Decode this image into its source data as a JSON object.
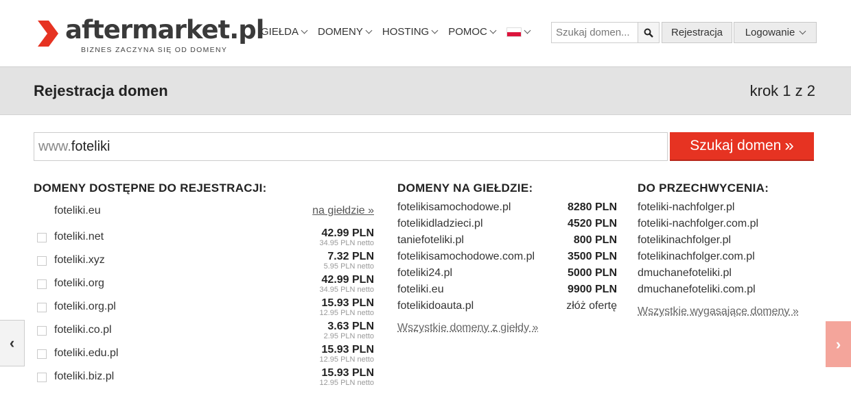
{
  "header": {
    "logo_name": "aftermarket.pl",
    "logo_tagline": "BIZNES ZACZYNA SIĘ OD DOMENY",
    "nav": [
      {
        "label": "GIEŁDA"
      },
      {
        "label": "DOMENY"
      },
      {
        "label": "HOSTING"
      },
      {
        "label": "POMOC"
      }
    ],
    "language_icon": "poland-flag-icon",
    "search_placeholder": "Szukaj domen...",
    "register_label": "Rejestracja",
    "login_label": "Logowanie"
  },
  "titlebar": {
    "title": "Rejestracja domen",
    "step": "krok 1 z 2"
  },
  "domain_search": {
    "prefix": "www.",
    "value": "foteliki",
    "button_label": "Szukaj domen",
    "button_icon": "double-chevron-right-icon"
  },
  "available": {
    "heading": "DOMENY DOSTĘPNE DO REJESTRACJI:",
    "first": {
      "domain": "foteliki.eu",
      "link": "na giełdzie »"
    },
    "items": [
      {
        "domain": "foteliki.net",
        "price": "42.99 PLN",
        "net": "34.95 PLN netto"
      },
      {
        "domain": "foteliki.xyz",
        "price": "7.32 PLN",
        "net": "5.95 PLN netto"
      },
      {
        "domain": "foteliki.org",
        "price": "42.99 PLN",
        "net": "34.95 PLN netto"
      },
      {
        "domain": "foteliki.org.pl",
        "price": "15.93 PLN",
        "net": "12.95 PLN netto"
      },
      {
        "domain": "foteliki.co.pl",
        "price": "3.63 PLN",
        "net": "2.95 PLN netto"
      },
      {
        "domain": "foteliki.edu.pl",
        "price": "15.93 PLN",
        "net": "12.95 PLN netto"
      },
      {
        "domain": "foteliki.biz.pl",
        "price": "15.93 PLN",
        "net": "12.95 PLN netto"
      }
    ]
  },
  "market": {
    "heading": "DOMENY NA GIEŁDZIE:",
    "items": [
      {
        "domain": "fotelikisamochodowe.pl",
        "price": "8280 PLN"
      },
      {
        "domain": "fotelikidladzieci.pl",
        "price": "4520 PLN"
      },
      {
        "domain": "taniefoteliki.pl",
        "price": "800 PLN"
      },
      {
        "domain": "fotelikisamochodowe.com.pl",
        "price": "3500 PLN"
      },
      {
        "domain": "foteliki24.pl",
        "price": "5000 PLN"
      },
      {
        "domain": "foteliki.eu",
        "price": "9900 PLN"
      },
      {
        "domain": "fotelikidoauta.pl",
        "offer": "złóż ofertę"
      }
    ],
    "all_link": "Wszystkie domeny z giełdy »"
  },
  "expiring": {
    "heading": "DO PRZECHWYCENIA:",
    "items": [
      "foteliki-nachfolger.pl",
      "foteliki-nachfolger.com.pl",
      "fotelikinachfolger.pl",
      "fotelikinachfolger.com.pl",
      "dmuchanefoteliki.pl",
      "dmuchanefoteliki.com.pl"
    ],
    "all_link": "Wszystkie wygasające domeny »"
  },
  "carousel": {
    "prev_icon": "chevron-left-icon",
    "next_icon": "chevron-right-icon"
  },
  "colors": {
    "brand_red": "#e63322",
    "header_gray": "#e3e3e3"
  }
}
